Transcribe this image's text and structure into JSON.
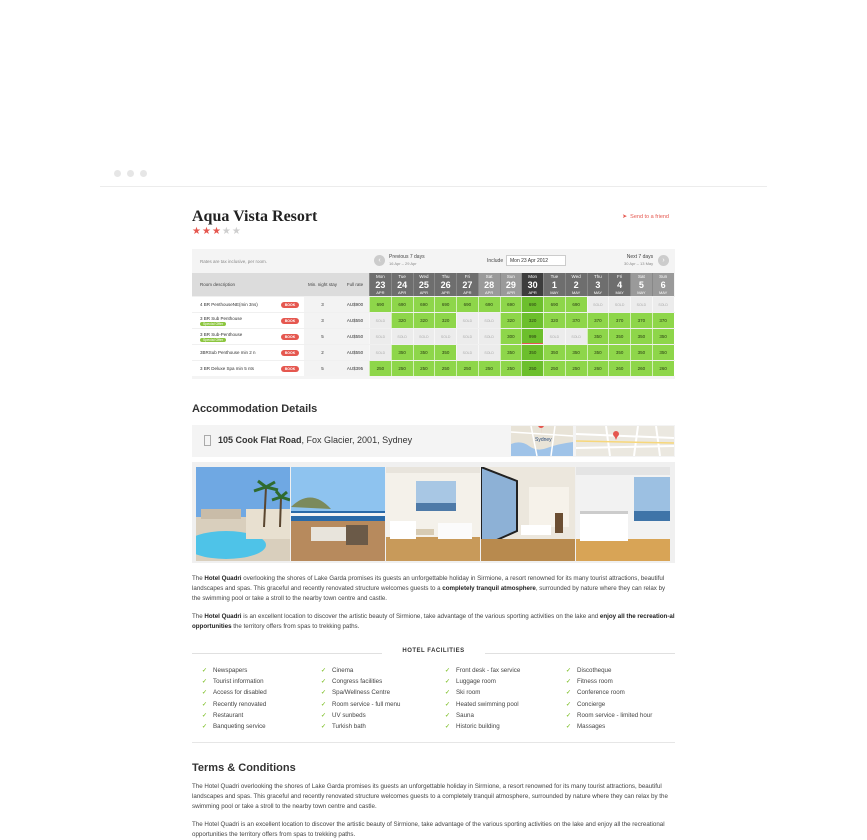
{
  "hotel": {
    "name": "Aqua Vista Resort",
    "stars_filled": 3,
    "stars_total": 5,
    "send_link": "Send to a friend"
  },
  "rates": {
    "tax_note": "Rates are tax inclusive, per room.",
    "prev_label": "Previous 7 days",
    "prev_range": "16 Apr – 29 Apr",
    "next_label": "Next 7 days",
    "next_range": "30 Apr – 13 May",
    "include_label": "Include",
    "include_value": "Mon 23 Apr 2012",
    "headers": {
      "room": "Room description",
      "min_stay": "Min. night stay",
      "full_rate": "Full rate"
    },
    "book_label": "BOOK",
    "special_label": "Special Offer",
    "sold_label": "SOLD",
    "dates": [
      {
        "day": "Mon",
        "num": "23",
        "month": "APR"
      },
      {
        "day": "Tue",
        "num": "24",
        "month": "APR"
      },
      {
        "day": "Wed",
        "num": "25",
        "month": "APR"
      },
      {
        "day": "Thu",
        "num": "26",
        "month": "APR"
      },
      {
        "day": "Fri",
        "num": "27",
        "month": "APR"
      },
      {
        "day": "Sat",
        "num": "28",
        "month": "APR"
      },
      {
        "day": "Sun",
        "num": "29",
        "month": "APR"
      },
      {
        "day": "Mon",
        "num": "30",
        "month": "APR"
      },
      {
        "day": "Tue",
        "num": "1",
        "month": "MAY"
      },
      {
        "day": "Wed",
        "num": "2",
        "month": "MAY"
      },
      {
        "day": "Thu",
        "num": "3",
        "month": "MAY"
      },
      {
        "day": "Fri",
        "num": "4",
        "month": "MAY"
      },
      {
        "day": "Sat",
        "num": "5",
        "month": "MAY"
      },
      {
        "day": "Sun",
        "num": "6",
        "month": "MAY"
      }
    ],
    "rooms": [
      {
        "name": "4 BR PenthouseNE(min 3ns)",
        "special": false,
        "min": "3",
        "rate": "AU$900",
        "prices": [
          "690",
          "690",
          "690",
          "690",
          "690",
          "690",
          "690",
          "690",
          "690",
          "690",
          "SOLD",
          "SOLD",
          "SOLD",
          "SOLD"
        ]
      },
      {
        "name": "3 BR Sub Penthouse",
        "special": true,
        "min": "3",
        "rate": "AU$550",
        "prices": [
          "SOLD",
          "320",
          "320",
          "320",
          "SOLD",
          "SOLD",
          "320",
          "320",
          "320",
          "370",
          "370",
          "370",
          "370",
          "370"
        ]
      },
      {
        "name": "3 BR Sub-Penthouse",
        "special": true,
        "min": "5",
        "rate": "AU$550",
        "prices": [
          "SOLD",
          "SOLD",
          "SOLD",
          "SOLD",
          "SOLD",
          "SOLD",
          "300",
          "999",
          "SOLD",
          "SOLD",
          "350",
          "350",
          "350",
          "350"
        ]
      },
      {
        "name": "3BRSub Penthouse min 2 n",
        "special": false,
        "min": "2",
        "rate": "AU$550",
        "prices": [
          "SOLD",
          "350",
          "350",
          "350",
          "SOLD",
          "SOLD",
          "350",
          "350",
          "350",
          "350",
          "350",
          "350",
          "350",
          "350"
        ]
      },
      {
        "name": "3 BR Deluxe Spa min 5 nts",
        "special": false,
        "min": "5",
        "rate": "AU$395",
        "prices": [
          "250",
          "250",
          "250",
          "250",
          "250",
          "250",
          "250",
          "250",
          "250",
          "250",
          "260",
          "260",
          "260",
          "260"
        ]
      }
    ]
  },
  "accommodation": {
    "title": "Accommodation Details",
    "address_street": "105 Cook Flat Road",
    "address_rest": ", Fox Glacier, 2001, Sydney",
    "map_label": "Sydney"
  },
  "description": {
    "p1_a": "The ",
    "p1_b": "Hotel Quadri",
    "p1_c": " overlooking the shores of Lake Garda promises its guests an unforgettable holiday in Sirmione, a resort renowned for its many tourist attractions, beautiful landscapes and spas. This graceful and recently renovated structure welcomes guests to a ",
    "p1_d": "completely tranquil atmosphere",
    "p1_e": ", surrounded by nature where they can relax by the swimming pool or take a stroll to the nearby town centre and castle.",
    "p2_a": "The ",
    "p2_b": "Hotel Quadri",
    "p2_c": " is an excellent location to discover the artistic beauty of Sirmione, take advantage of the various sporting activities on the lake and ",
    "p2_d": "enjoy all the recreation-al opportunities",
    "p2_e": " the territory offers from spas to trekking paths."
  },
  "facilities": {
    "title": "HOTEL FACILITIES",
    "col1": [
      "Newspapers",
      "Tourist information",
      "Access for disabled",
      "Recently renovated",
      "Restaurant",
      "Banqueting service"
    ],
    "col2": [
      "Cinema",
      "Congress facilities",
      "Spa/Wellness Centre",
      "Room service - full menu",
      "UV sunbeds",
      "Turkish bath"
    ],
    "col3": [
      "Front desk - fax service",
      "Luggage room",
      "Ski room",
      "Heated swimming pool",
      "Sauna",
      "Historic building"
    ],
    "col4": [
      "Discotheque",
      "Fitness room",
      "Conference room",
      "Concierge",
      "Room service - limited hour",
      "Massages"
    ]
  },
  "terms": {
    "title": "Terms & Conditions",
    "p1": "The Hotel Quadri overlooking the shores of Lake Garda promises its guests an unforgettable holiday in Sirmione, a resort renowned for its many tourist attractions, beautiful landscapes and spas. This graceful and recently renovated structure welcomes guests to a completely tranquil atmosphere, surrounded by nature where they can relax by the swimming pool or take a stroll to the nearby town centre and castle.",
    "p2": "The Hotel Quadri is an excellent location to discover the artistic beauty of Sirmione, take advantage of the various sporting activities on the lake and enjoy all the recreational opportunities the territory offers from spas to trekking paths."
  },
  "colors": {
    "accent": "#e5574f",
    "available": "#8ed64a",
    "check": "#8cc63f"
  }
}
